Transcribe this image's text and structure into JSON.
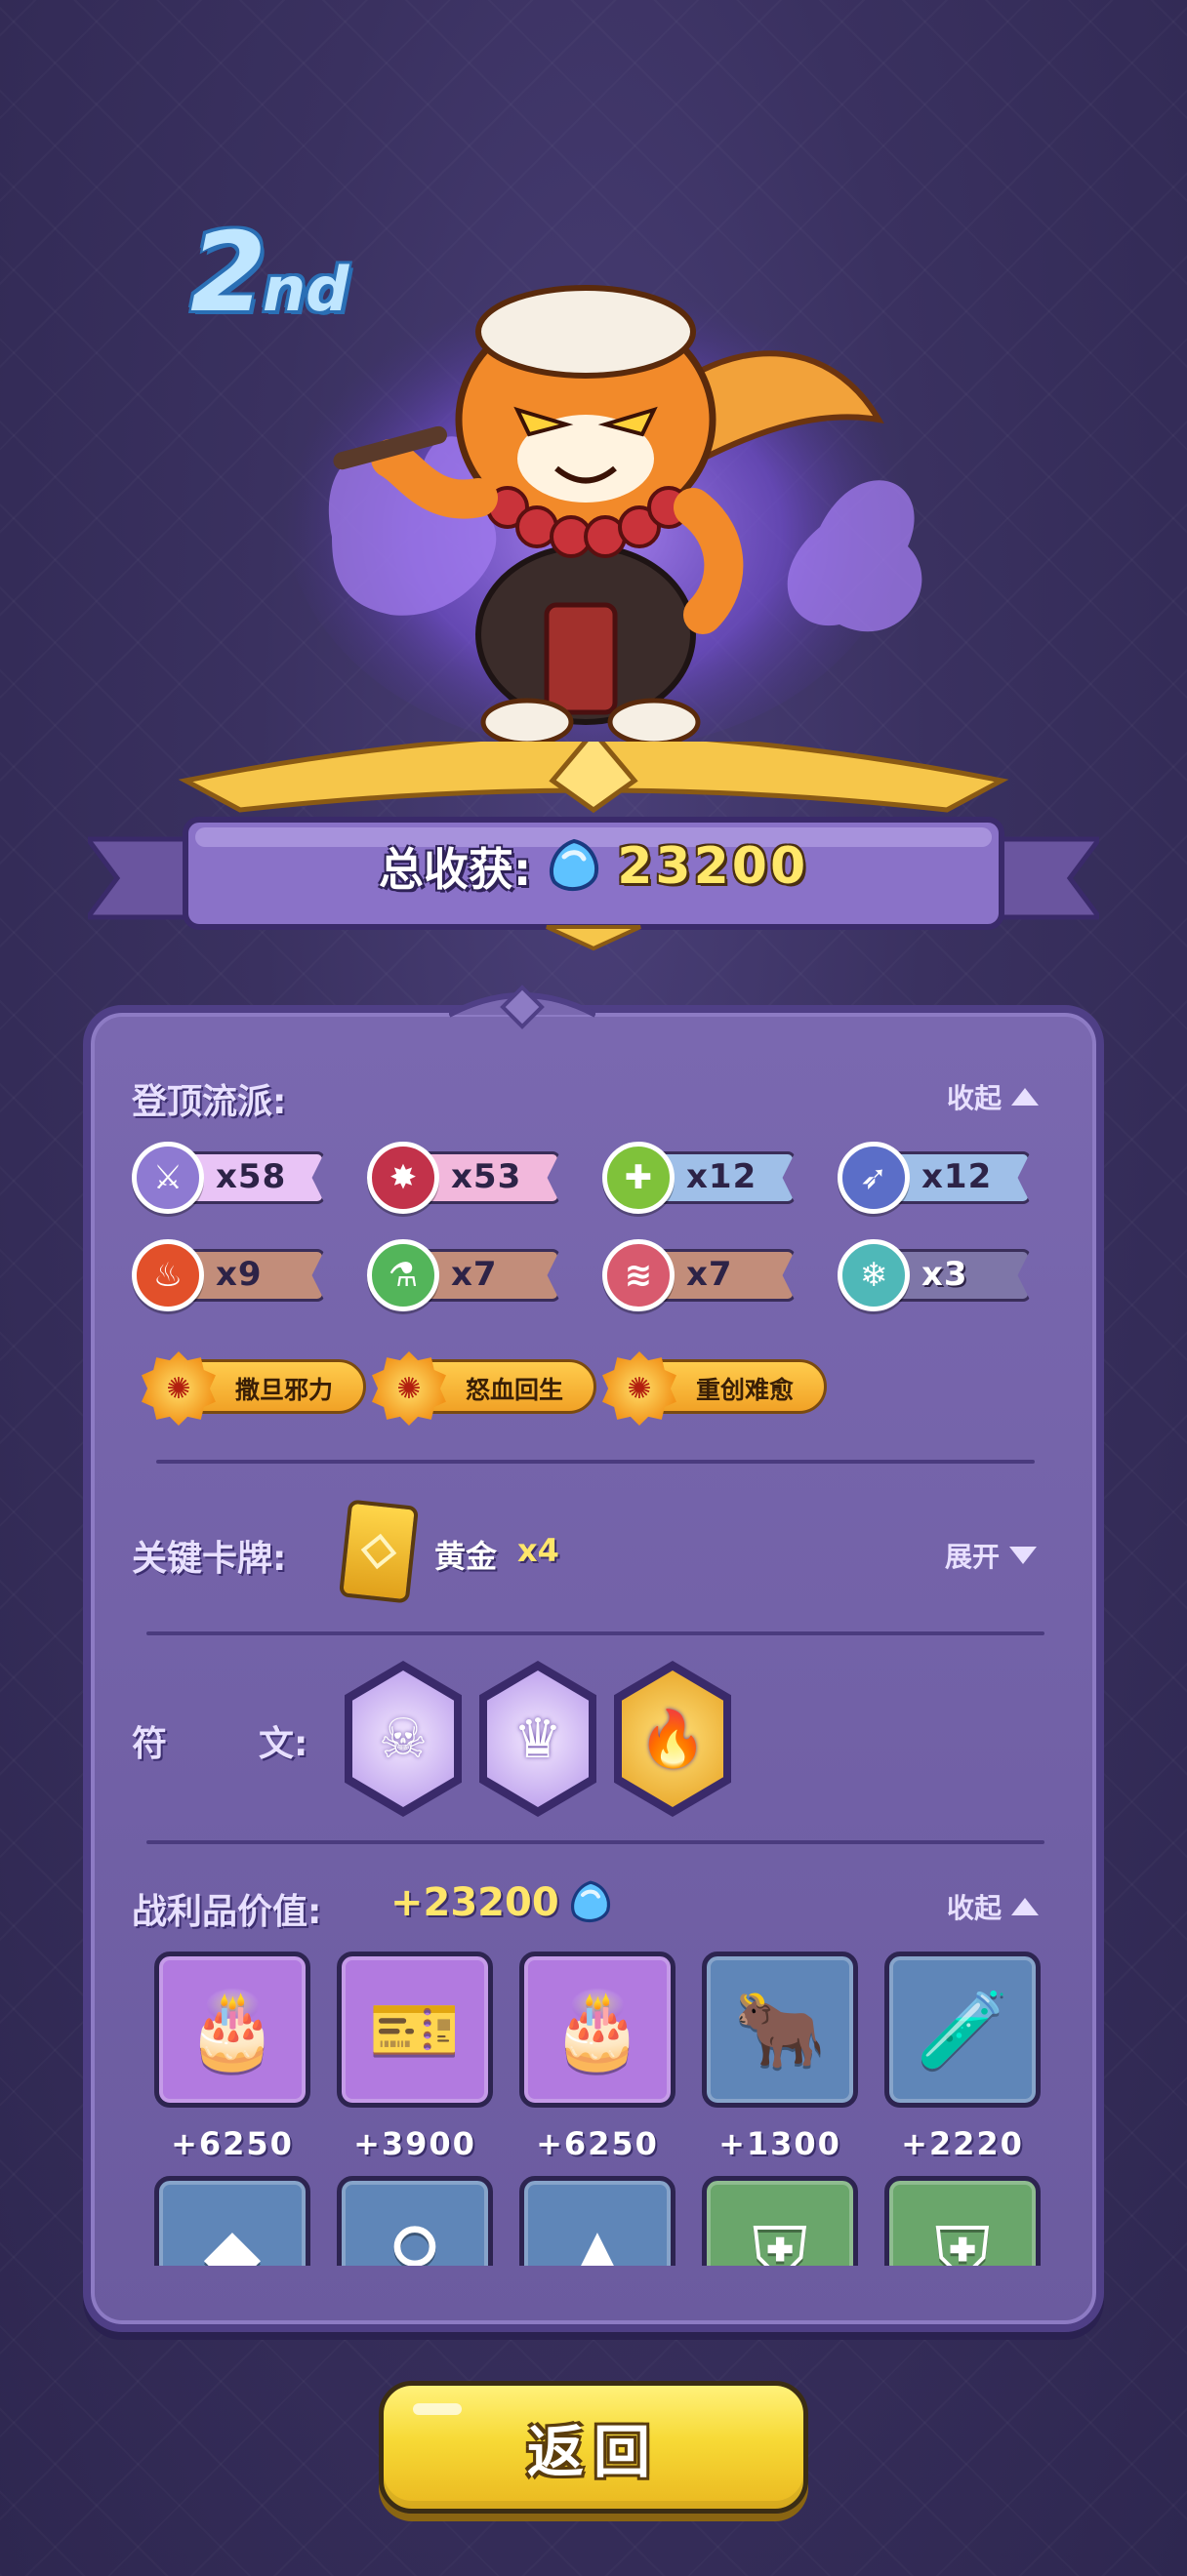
{
  "rank": {
    "number": "2",
    "suffix": "nd"
  },
  "summary": {
    "total_label": "总收获:",
    "total_value": "23200"
  },
  "build": {
    "title": "登顶流派:",
    "toggle_label": "收起",
    "chips": [
      {
        "icon": "sword-icon",
        "count": "x58",
        "color": "#e9c4f6",
        "icon_color": "#8e7ad2"
      },
      {
        "icon": "flame-burst-icon",
        "count": "x53",
        "color": "#f2b8dc",
        "icon_color": "#c2324a"
      },
      {
        "icon": "heal-cross-icon",
        "count": "x12",
        "color": "#9fbfe8",
        "icon_color": "#7fc23a"
      },
      {
        "icon": "boot-icon",
        "count": "x12",
        "color": "#9fbfe8",
        "icon_color": "#5b6ec8"
      },
      {
        "icon": "fire-orb-icon",
        "count": "x9",
        "color": "#c28d7a",
        "icon_color": "#e2502a"
      },
      {
        "icon": "potion-icon",
        "count": "x7",
        "color": "#c28d7a",
        "icon_color": "#53b55a"
      },
      {
        "icon": "claw-icon",
        "count": "x7",
        "color": "#c28d7a",
        "icon_color": "#d85a6e"
      },
      {
        "icon": "snowflake-icon",
        "count": "x3",
        "color": "#7e76a8",
        "icon_color": "#4fb8b8"
      }
    ],
    "traits": [
      "撒旦邪力",
      "怒血回生",
      "重创难愈"
    ]
  },
  "key_cards": {
    "title": "关键卡牌:",
    "card_name": "黄金",
    "card_count": "x4",
    "toggle_label": "展开"
  },
  "runes": {
    "title": "符",
    "title_2": "文:",
    "items": [
      {
        "icon": "ghost-anchor-icon",
        "frame": "#c8b0f0"
      },
      {
        "icon": "crown-icon",
        "frame": "#c8b0f0"
      },
      {
        "icon": "flaming-blade-icon",
        "frame": "#f3c03a"
      }
    ]
  },
  "loot": {
    "title": "战利品价值:",
    "value": "+23200",
    "toggle_label": "收起",
    "items": [
      {
        "icon": "cake-icon",
        "value": "+6250",
        "bg": "#b27ae0"
      },
      {
        "icon": "vip-ticket-icon",
        "value": "+3900",
        "bg": "#b27ae0"
      },
      {
        "icon": "cake-icon",
        "value": "+6250",
        "bg": "#b27ae0"
      },
      {
        "icon": "bull-totem-icon",
        "value": "+1300",
        "bg": "#5f86b8"
      },
      {
        "icon": "potion-bottle-icon",
        "value": "+2220",
        "bg": "#5f86b8"
      },
      {
        "icon": "crystal-icon",
        "value": "",
        "bg": "#5f86b8"
      },
      {
        "icon": "keyring-icon",
        "value": "",
        "bg": "#5f86b8"
      },
      {
        "icon": "fin-icon",
        "value": "",
        "bg": "#5f86b8"
      },
      {
        "icon": "shield-card-icon",
        "value": "",
        "bg": "#6aa66b"
      },
      {
        "icon": "shield-card-icon",
        "value": "",
        "bg": "#6aa66b"
      }
    ]
  },
  "back_button": {
    "label": "返回"
  },
  "colors": {
    "accent_gold": "#ffe86a",
    "panel": "#7a68b0",
    "gem": "#4aa8f0"
  }
}
